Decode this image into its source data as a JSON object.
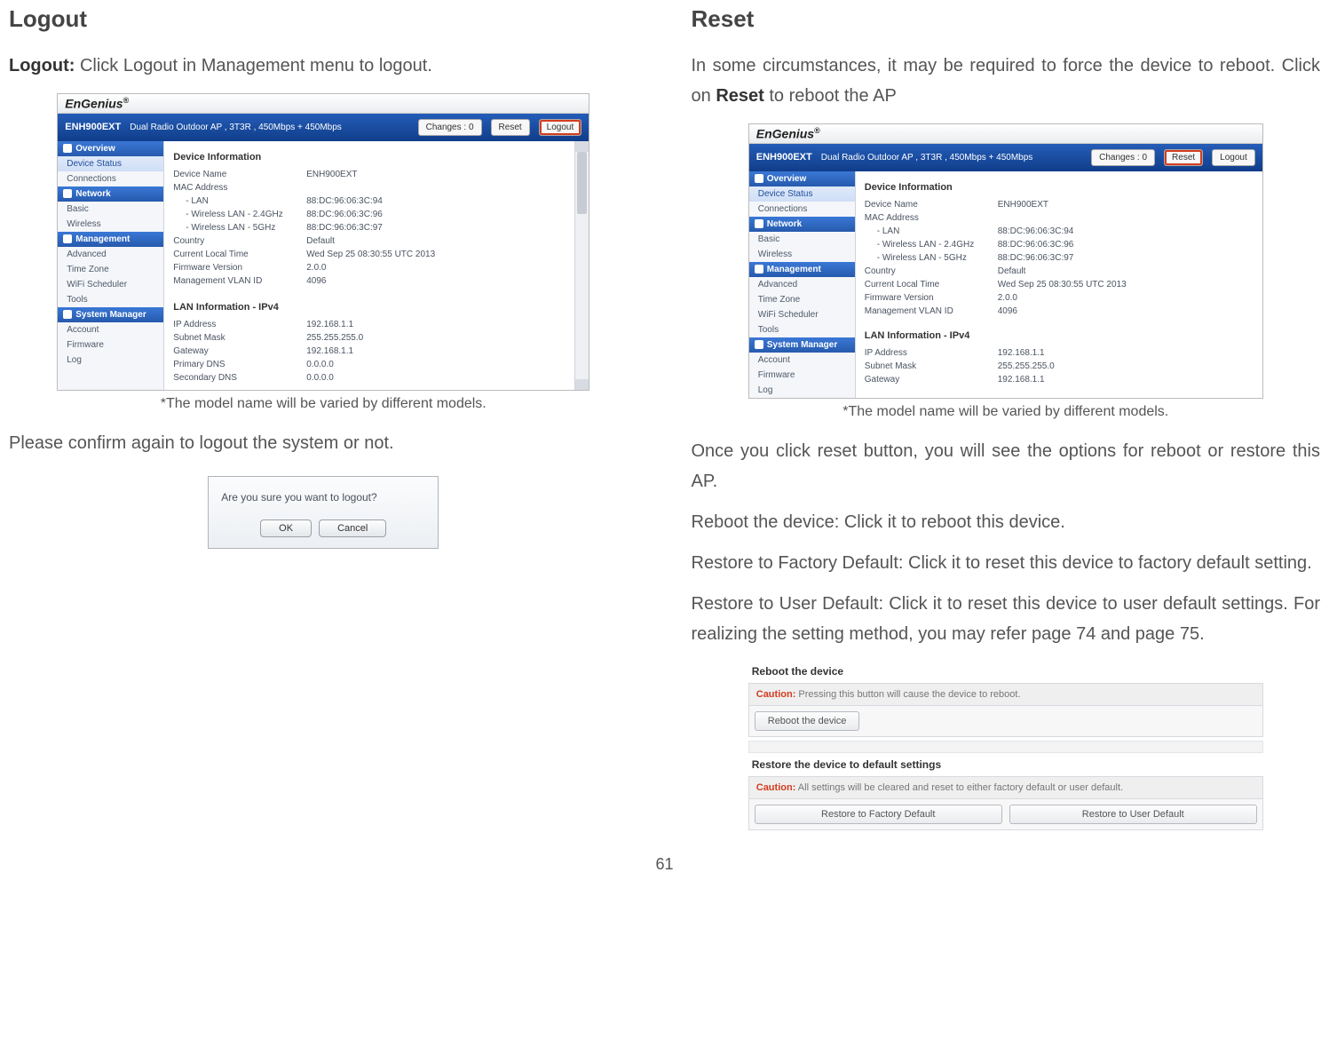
{
  "page_number": "61",
  "left": {
    "title": "Logout",
    "intro_bold": "Logout:",
    "intro_rest": " Click Logout in Management menu to logout.",
    "note": "*The model name will be varied by different models.",
    "confirm_lead": "Please confirm again to logout the system or not.",
    "dialog": {
      "message": "Are you sure you want to logout?",
      "ok": "OK",
      "cancel": "Cancel"
    }
  },
  "right": {
    "title": "Reset",
    "p1_a": "In some circumstances, it may be required to force the device to reboot. Click on ",
    "p1_bold": "Reset",
    "p1_b": " to reboot the AP",
    "note": "*The model name will be varied by different models.",
    "p2": "Once you click reset button, you will see the options for reboot or restore this AP.",
    "p3": "Reboot the device: Click it to reboot this device.",
    "p4": "Restore to Factory Default: Click it to reset this device to factory default setting.",
    "p5": "Restore to User Default: Click it to reset this device to user default settings. For realizing the setting method, you may refer page 74 and page 75.",
    "rr": {
      "t1": "Reboot the device",
      "c1a": "Caution:",
      "c1b": " Pressing this button will cause the device to reboot.",
      "b1": "Reboot the device",
      "t2": "Restore the device to default settings",
      "c2a": "Caution:",
      "c2b": " All settings will be cleared and reset to either factory default or user default.",
      "b2a": "Restore to Factory Default",
      "b2b": "Restore to User Default"
    }
  },
  "admin": {
    "logo": "EnGenius",
    "logo_reg": "®",
    "model": "ENH900EXT",
    "desc": "Dual Radio Outdoor AP , 3T3R , 450Mbps + 450Mbps",
    "changes": "Changes : 0",
    "reset": "Reset",
    "logout": "Logout",
    "side": {
      "overview": "Overview",
      "device_status": "Device Status",
      "connections": "Connections",
      "network": "Network",
      "basic": "Basic",
      "wireless": "Wireless",
      "management": "Management",
      "advanced": "Advanced",
      "timezone": "Time Zone",
      "wifisched": "WiFi Scheduler",
      "tools": "Tools",
      "sysmgr": "System Manager",
      "account": "Account",
      "firmware": "Firmware",
      "log": "Log"
    },
    "info": {
      "h1": "Device Information",
      "devname_k": "Device Name",
      "devname_v": "ENH900EXT",
      "mac_k": "MAC Address",
      "lan_k": "- LAN",
      "lan_v": "88:DC:96:06:3C:94",
      "w24_k": "- Wireless LAN - 2.4GHz",
      "w24_v": "88:DC:96:06:3C:96",
      "w5_k": "- Wireless LAN - 5GHz",
      "w5_v": "88:DC:96:06:3C:97",
      "country_k": "Country",
      "country_v": "Default",
      "time_k": "Current Local Time",
      "time_v": "Wed Sep 25 08:30:55 UTC 2013",
      "fw_k": "Firmware Version",
      "fw_v": "2.0.0",
      "vlan_k": "Management VLAN ID",
      "vlan_v": "4096",
      "h2": "LAN Information - IPv4",
      "ip_k": "IP Address",
      "ip_v": "192.168.1.1",
      "sm_k": "Subnet Mask",
      "sm_v": "255.255.255.0",
      "gw_k": "Gateway",
      "gw_v": "192.168.1.1",
      "pdns_k": "Primary DNS",
      "pdns_v": "0.0.0.0",
      "sdns_k": "Secondary DNS",
      "sdns_v": "0.0.0.0"
    }
  }
}
